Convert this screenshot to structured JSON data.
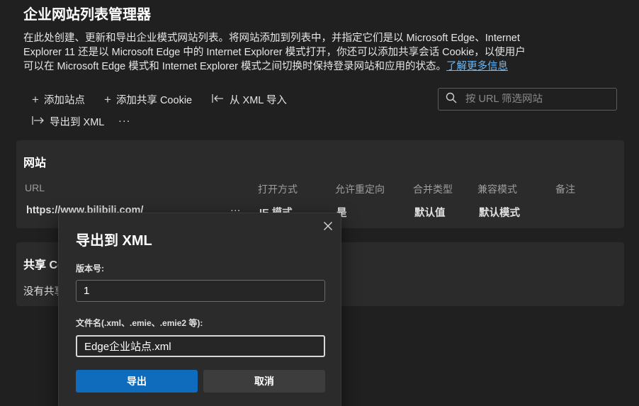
{
  "page": {
    "title": "企业网站列表管理器",
    "description": "在此处创建、更新和导出企业模式网站列表。将网站添加到列表中，并指定它们是以 Microsoft Edge、Internet Explorer 11 还是以 Microsoft Edge 中的 Internet Explorer 模式打开，你还可以添加共享会话 Cookie，以使用户可以在 Microsoft Edge 模式和 Internet Explorer 模式之间切换时保持登录网站和应用的状态。",
    "learn_more": "了解更多信息"
  },
  "toolbar": {
    "add_site": "添加站点",
    "add_cookie": "添加共享 Cookie",
    "import_xml": "从 XML 导入",
    "export_xml": "导出到 XML",
    "more": "···",
    "search_placeholder": "按 URL 筛选网站"
  },
  "sites": {
    "title": "网站",
    "columns": [
      "URL",
      "打开方式",
      "允许重定向",
      "合并类型",
      "兼容模式",
      "备注"
    ],
    "rows": [
      {
        "url": "https://www.bilibili.com/",
        "more": "···",
        "open_in": "IE 模式",
        "allow_redirect": "是",
        "merge_type": "默认值",
        "compat_mode": "默认模式",
        "comment": ""
      }
    ]
  },
  "cookies": {
    "title": "共享 Co",
    "empty": "没有共享"
  },
  "dialog": {
    "title": "导出到 XML",
    "version_label": "版本号:",
    "version_value": "1",
    "filename_label": "文件名(.xml、.emie、.emie2 等):",
    "filename_value": "Edge企业站点.xml",
    "export_button": "导出",
    "cancel_button": "取消"
  },
  "colors": {
    "background": "#202020",
    "card": "#2b2b2b",
    "accent": "#0f6cbd",
    "link": "#6cb8f6"
  }
}
